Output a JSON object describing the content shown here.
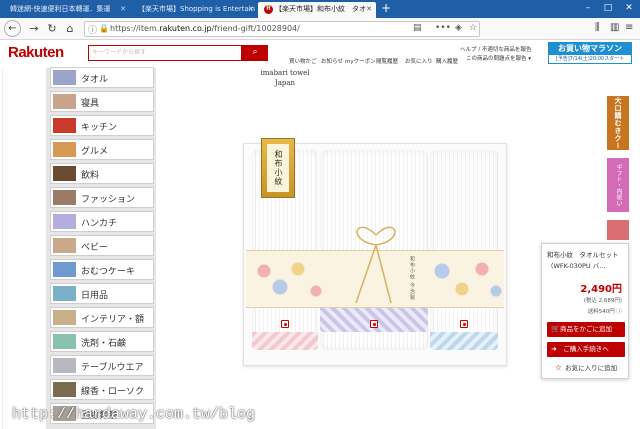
{
  "browser": {
    "tabs": [
      {
        "title": "韓迷網-快速便利日本轉運．集運",
        "active": false
      },
      {
        "title": "【楽天市場】Shopping is Entertain",
        "active": false
      },
      {
        "title": "【楽天市場】和布小紋　タオ",
        "active": true
      }
    ],
    "url_prefix": "https://item.",
    "url_domain": "rakuten.co.jp",
    "url_path": "/friend-gift/10028904/",
    "url_more": "•••"
  },
  "header": {
    "logo": "Rakuten",
    "search_placeholder": "キーワードから探す",
    "links": [
      "買い物かご",
      "お知らせ",
      "myクーポン",
      "閲覧履歴",
      "お気に入り",
      "購入履歴"
    ],
    "help_line1": "ヘルプ / 不適切な商品を報告",
    "help_line2": "この商品の問題点を報告 ▾",
    "marathon_title": "お買い物マラソン",
    "marathon_sub": "[予告]7/14(土)20:00スタート"
  },
  "sidebar": {
    "categories": [
      {
        "label": "タオル",
        "color": "#9aa3c8"
      },
      {
        "label": "寝具",
        "color": "#c8a48a"
      },
      {
        "label": "キッチン",
        "color": "#c83a2a"
      },
      {
        "label": "グルメ",
        "color": "#d69a55"
      },
      {
        "label": "飲料",
        "color": "#6a4a30"
      },
      {
        "label": "ファッション",
        "color": "#9b7a68"
      },
      {
        "label": "ハンカチ",
        "color": "#b4aee0"
      },
      {
        "label": "ベビー",
        "color": "#c9a98a"
      },
      {
        "label": "おむつケーキ",
        "color": "#6e9ad0"
      },
      {
        "label": "日用品",
        "color": "#7ab0c8"
      },
      {
        "label": "インテリア・額",
        "color": "#c8b088"
      },
      {
        "label": "洗剤・石鹸",
        "color": "#8ac2b0"
      },
      {
        "label": "テーブルウエア",
        "color": "#b8b8c0"
      },
      {
        "label": "線香・ローソク",
        "color": "#7a6a50"
      },
      {
        "label": "回線葬祭",
        "color": "#aaa09a"
      }
    ]
  },
  "product": {
    "brand_line1": "imabari towel",
    "brand_line2": "Japan",
    "package_label": "和布小紋",
    "sleeve_text": "和布小紋 今治製"
  },
  "panel": {
    "name": "和布小紋　タオルセット（WFK-030PU バ…",
    "price": "2,490円",
    "tax": "(税込 2,689円)",
    "shipping": "送料540円",
    "cart_button": "商品をかごに追加",
    "buy_button": "ご購入手続きへ",
    "fav_button": "お気に入りに追加"
  },
  "side_banners": {
    "coupon": "大口購むきクーポン",
    "banner2": "ギフト・内祝い"
  },
  "watermark": "http://hardaway.com.tw/blog"
}
